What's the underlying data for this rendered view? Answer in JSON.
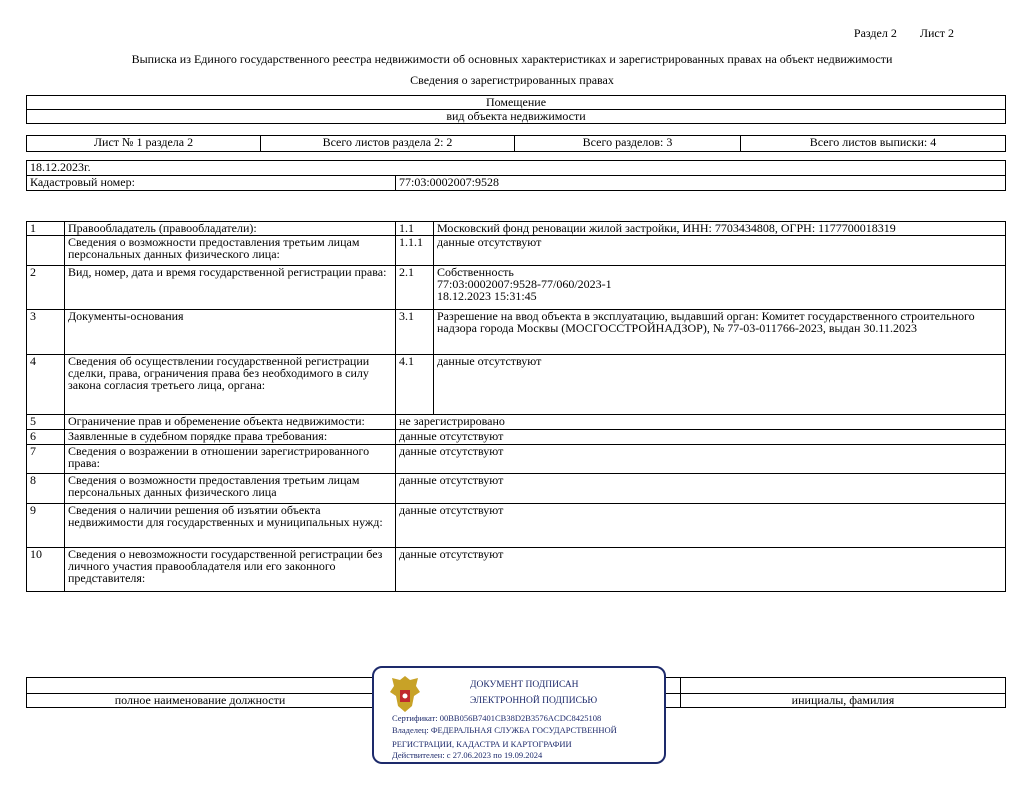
{
  "header": {
    "section": "Раздел 2",
    "sheet": "Лист 2",
    "title": "Выписка из Единого государственного реестра недвижимости об основных характеристиках и зарегистрированных правах на объект недвижимости",
    "subtitle": "Сведения о зарегистрированных правах"
  },
  "object": {
    "name": "Помещение",
    "kind_label": "вид объекта недвижимости"
  },
  "sheets": {
    "sheet_no": "Лист № 1 раздела 2",
    "total_sheets_section": "Всего листов раздела 2: 2",
    "total_sections": "Всего разделов: 3",
    "total_sheets": "Всего листов выписки: 4"
  },
  "info": {
    "date": "18.12.2023г.",
    "cadastral_label": "Кадастровый номер:",
    "cadastral_value": "77:03:0002007:9528"
  },
  "rows": [
    {
      "num": "1",
      "label": "Правообладатель (правообладатели):",
      "sub": "1.1",
      "value": "Московский фонд реновации жилой застройки, ИНН: 7703434808, ОГРН: 1177700018319"
    },
    {
      "num": "",
      "label": "Сведения о возможности предоставления третьим лицам персональных данных физического лица:",
      "sub": "1.1.1",
      "value": "данные отсутствуют"
    },
    {
      "num": "2",
      "label": "Вид, номер, дата и время государственной регистрации права:",
      "sub": "2.1",
      "value": "Собственность\n77:03:0002007:9528-77/060/2023-1\n18.12.2023 15:31:45"
    },
    {
      "num": "3",
      "label": "Документы-основания",
      "sub": "3.1",
      "value": "Разрешение на ввод объекта в эксплуатацию, выдавший орган: Комитет государственного строительного надзора города Москвы (МОСГОССТРОЙНАДЗОР), № 77-03-011766-2023, выдан 30.11.2023"
    },
    {
      "num": "4",
      "label": "Сведения об осуществлении государственной регистрации сделки, права, ограничения права без необходимого в силу закона согласия третьего лица, органа:",
      "sub": "4.1",
      "value": "данные отсутствуют"
    },
    {
      "num": "5",
      "label": "Ограничение прав и обременение объекта недвижимости:",
      "sub": "",
      "value": "не зарегистрировано"
    },
    {
      "num": "6",
      "label": "Заявленные в судебном порядке права требования:",
      "sub": "",
      "value": "данные отсутствуют"
    },
    {
      "num": "7",
      "label": "Сведения о возражении в отношении зарегистрированного права:",
      "sub": "",
      "value": "данные отсутствуют"
    },
    {
      "num": "8",
      "label": "Сведения о возможности предоставления третьим лицам персональных данных физического лица",
      "sub": "",
      "value": "данные отсутствуют"
    },
    {
      "num": "9",
      "label": "Сведения о наличии решения об изъятии объекта недвижимости для государственных и муниципальных нужд:",
      "sub": "",
      "value": "данные отсутствуют"
    },
    {
      "num": "10",
      "label": "Сведения о невозможности государственной регистрации без личного участия правообладателя или его законного представителя:",
      "sub": "",
      "value": "данные отсутствуют"
    }
  ],
  "footer": {
    "position_label": "полное наименование должности",
    "name_label": "инициалы, фамилия"
  },
  "stamp": {
    "line1": "ДОКУМЕНТ ПОДПИСАН",
    "line2": "ЭЛЕКТРОННОЙ ПОДПИСЬЮ",
    "cert": "Сертификат: 00BB056B7401CB38D2B3576ACDC8425108",
    "owner1": "Владелец: ФЕДЕРАЛЬНАЯ СЛУЖБА ГОСУДАРСТВЕННОЙ",
    "owner2": "РЕГИСТРАЦИИ, КАДАСТРА И КАРТОГРАФИИ",
    "valid": "Действителен: с 27.06.2023 по 19.09.2024",
    "color": "#1d2a6b"
  }
}
